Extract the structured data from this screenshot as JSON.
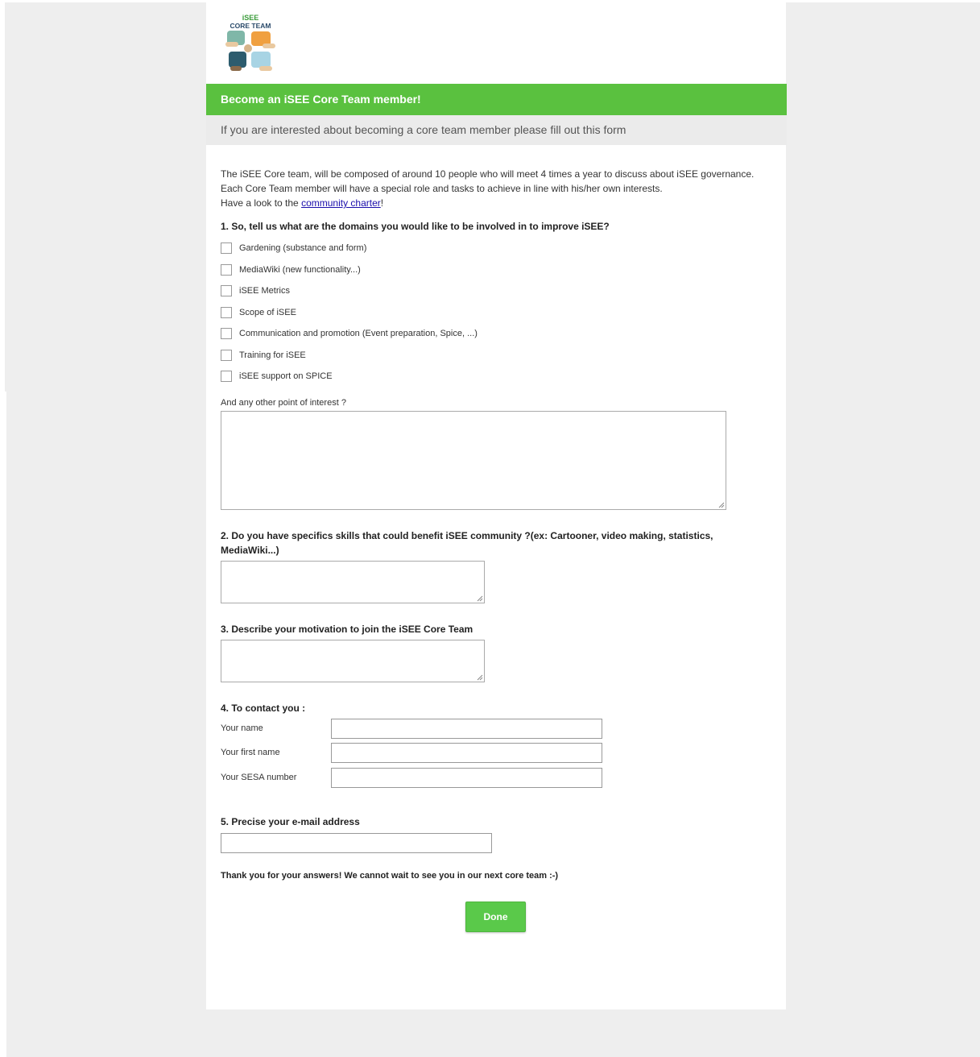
{
  "logo": {
    "line1": "iSEE",
    "line2": "CORE TEAM"
  },
  "header": {
    "title": "Become an iSEE Core Team member!"
  },
  "subheader": {
    "text": "If you are interested about becoming a core team member please fill out this form"
  },
  "intro": {
    "line1": "The iSEE Core team, will be composed of around 10 people who will meet 4 times a year to discuss about iSEE governance.",
    "line2": "Each Core Team member will have a special role and tasks to achieve in line with his/her own interests.",
    "line3_prefix": "Have a look to the ",
    "link": "community charter",
    "line3_suffix": "!"
  },
  "q1": {
    "title": "1. So, tell us what are the domains you would like to be involved in to improve iSEE?",
    "options": [
      "Gardening (substance and form)",
      "MediaWiki (new functionality...)",
      "iSEE Metrics",
      "Scope of iSEE",
      "Communication and promotion (Event preparation, Spice, ...)",
      "Training for iSEE",
      "iSEE support on SPICE"
    ],
    "other_label": "And any other point of interest ?"
  },
  "q2": {
    "line1": "2. Do you have specifics skills that could benefit iSEE community ?(ex: Cartooner, video making, statistics,",
    "line2": "MediaWiki...)"
  },
  "q3": {
    "title": "3. Describe your motivation to join the iSEE Core Team"
  },
  "q4": {
    "title": "4. To contact you :",
    "fields": [
      "Your name",
      "Your first name",
      "Your SESA number"
    ]
  },
  "q5": {
    "title": "5. Precise your e-mail address"
  },
  "thanks": "Thank you for your answers! We cannot wait to see you in our next core team :-)",
  "done_label": "Done",
  "colors": {
    "accent": "#5ac13f",
    "subheader_bg": "#ebebeb",
    "page_bg": "#eeeeee"
  }
}
